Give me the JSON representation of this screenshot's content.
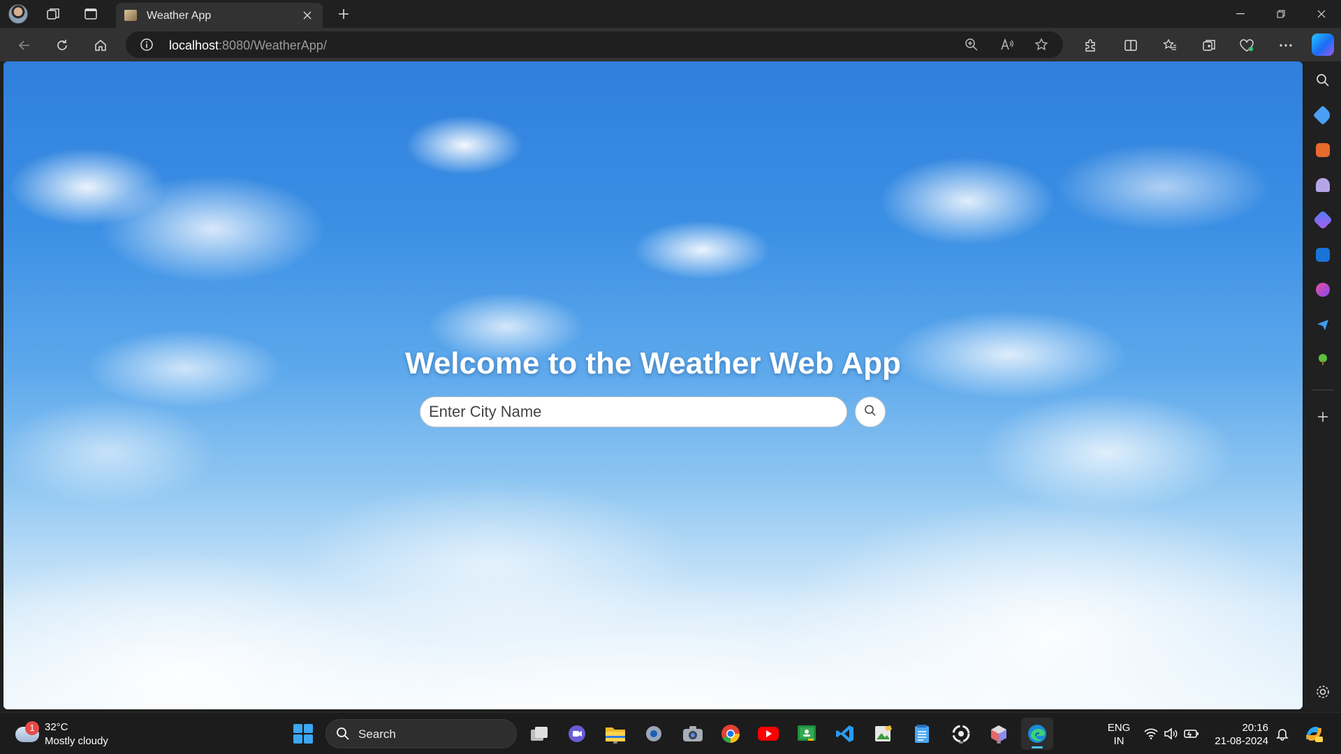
{
  "browser": {
    "tab": {
      "title": "Weather App"
    },
    "url": {
      "host": "localhost",
      "path": ":8080/WeatherApp/"
    }
  },
  "page": {
    "heading": "Welcome to the Weather Web App",
    "search": {
      "placeholder": "Enter City Name",
      "value": ""
    }
  },
  "taskbar": {
    "weather": {
      "badge": "1",
      "temp": "32°C",
      "condition": "Mostly cloudy"
    },
    "search_label": "Search",
    "language": {
      "line1": "ENG",
      "line2": "IN"
    },
    "clock": {
      "time": "20:16",
      "date": "21-08-2024"
    }
  },
  "colors": {
    "sky_top": "#2f7fdc",
    "sky_bottom": "#eef7fd",
    "heading_text": "#ffffff",
    "browser_chrome": "#323232",
    "taskbar": "#1c1c1c",
    "edge_accent": "#4cc2ff"
  },
  "icons": {
    "titlebar": [
      "profile-avatar",
      "workspaces-icon",
      "vertical-tabs-icon",
      "tab-favicon",
      "tab-close-icon",
      "new-tab-icon",
      "minimize-icon",
      "restore-icon",
      "close-window-icon"
    ],
    "navbar": [
      "back-icon",
      "reload-icon",
      "home-icon",
      "site-info-icon",
      "zoom-icon",
      "read-aloud-icon",
      "favorite-star-icon",
      "extensions-icon",
      "split-screen-icon",
      "favorites-icon",
      "collections-icon",
      "browser-essentials-icon",
      "more-icon",
      "copilot-icon"
    ],
    "sidebar": [
      "search-icon",
      "shopping-icon",
      "tools-icon",
      "games-icon",
      "microsoft365-icon",
      "outlook-icon",
      "designer-icon",
      "drop-icon",
      "tree-icon",
      "add-icon",
      "settings-icon"
    ],
    "taskbar": [
      "start-icon",
      "search-icon",
      "task-view-icon",
      "chat-icon",
      "file-explorer-icon",
      "settings-icon",
      "camera-icon",
      "chrome-icon",
      "youtube-icon",
      "classroom-icon",
      "vscode-icon",
      "photos-icon",
      "notepad-icon",
      "linux-icon",
      "package-icon",
      "edge-icon",
      "wifi-icon",
      "volume-icon",
      "battery-icon",
      "notifications-icon",
      "copilot-icon"
    ]
  }
}
